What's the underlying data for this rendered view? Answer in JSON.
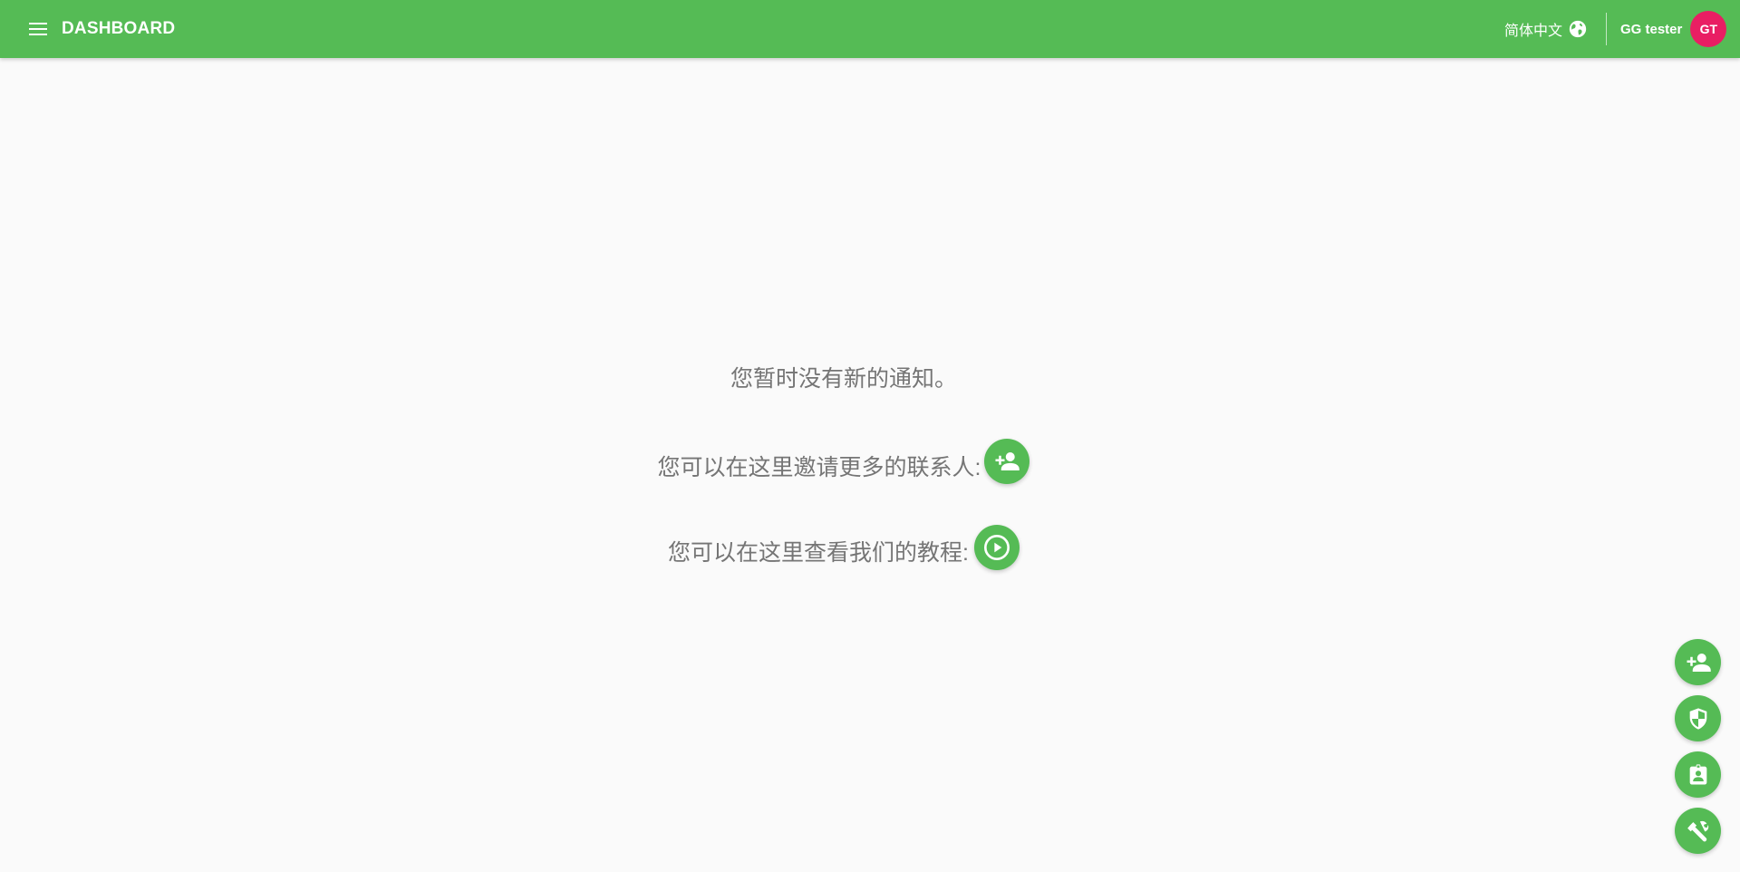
{
  "header": {
    "title": "DASHBOARD",
    "menu_icon": "menu-icon",
    "language": {
      "label": "简体中文",
      "icon": "globe-icon"
    },
    "user": {
      "name": "GG tester",
      "initials": "GT",
      "avatar_color": "#e91e63"
    }
  },
  "main": {
    "no_notifications": "您暂时没有新的通知。",
    "invite_text": "您可以在这里邀请更多的联系人:",
    "invite_icon": "add-person-icon",
    "tutorial_text": "您可以在这里查看我们的教程:",
    "tutorial_icon": "play-circle-icon"
  },
  "fab": [
    {
      "icon": "add-person-icon"
    },
    {
      "icon": "shield-icon"
    },
    {
      "icon": "contact-badge-icon"
    },
    {
      "icon": "wrench-icon"
    }
  ],
  "colors": {
    "primary": "#55bb55",
    "accent": "#e91e63",
    "background": "#fafafa",
    "text_muted": "#757575"
  }
}
